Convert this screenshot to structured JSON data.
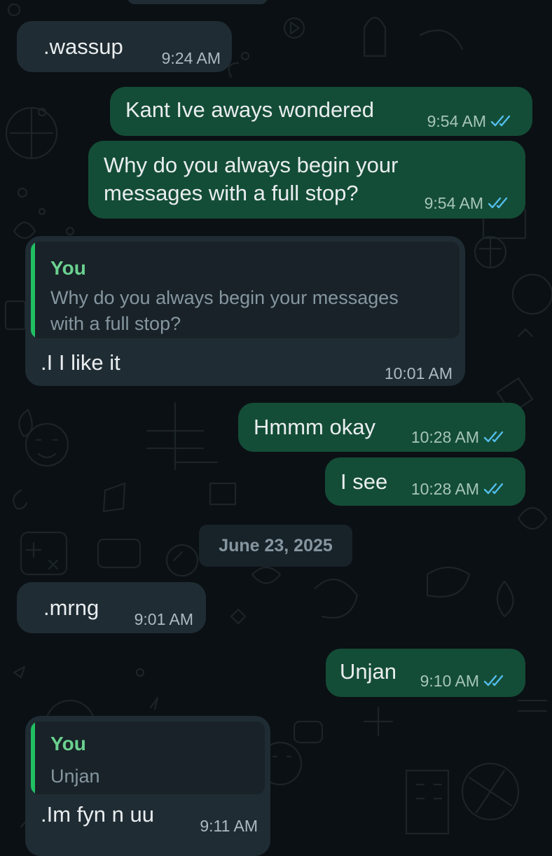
{
  "colors": {
    "background": "#0b1014",
    "incoming_bubble": "#1f2c33",
    "outgoing_bubble": "#144d37",
    "quote_bar": "#21c063",
    "quote_author": "#6bd18f",
    "read_tick": "#53bdeb"
  },
  "messages": [
    {
      "direction": "incoming",
      "text": ".wassup",
      "time": "9:24 AM"
    },
    {
      "direction": "outgoing",
      "text": "Kant Ive aways wondered",
      "time": "9:54 AM",
      "status": "read"
    },
    {
      "direction": "outgoing",
      "text_lines": [
        "Why do you always begin your",
        "messages with a full stop?"
      ],
      "time": "9:54 AM",
      "status": "read"
    },
    {
      "direction": "incoming",
      "quote": {
        "author": "You",
        "text_lines": [
          "Why do you always begin your messages",
          "with a full stop?"
        ]
      },
      "text": ".I I like it",
      "time": "10:01 AM"
    },
    {
      "direction": "outgoing",
      "text": "Hmmm okay",
      "time": "10:28 AM",
      "status": "read"
    },
    {
      "direction": "outgoing",
      "text": "I see",
      "time": "10:28 AM",
      "status": "read"
    },
    {
      "direction": "incoming",
      "text": ".mrng",
      "time": "9:01 AM"
    },
    {
      "direction": "outgoing",
      "text": "Unjan",
      "time": "9:10 AM",
      "status": "read"
    },
    {
      "direction": "incoming",
      "quote": {
        "author": "You",
        "text": "Unjan"
      },
      "text": ".Im fyn n uu",
      "time": "9:11 AM"
    }
  ],
  "date_divider": "June 23, 2025",
  "icons": {
    "read_receipt": "double-check-icon",
    "wallpaper": "doodle-pattern"
  }
}
